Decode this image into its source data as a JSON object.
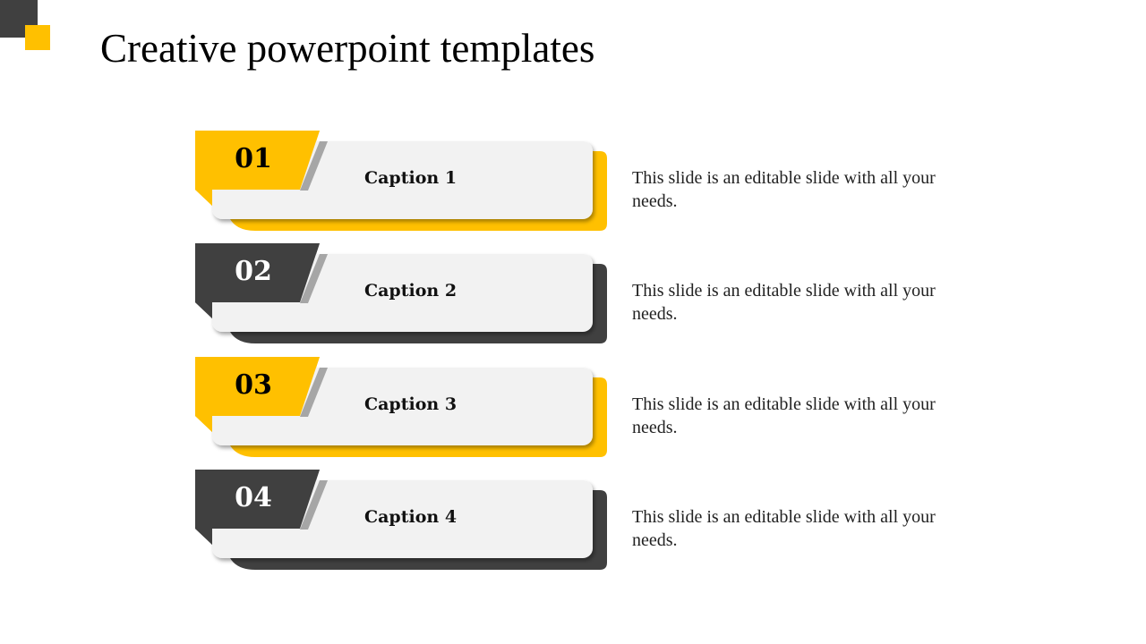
{
  "title": "Creative powerpoint templates",
  "colors": {
    "accent": "#FFC000",
    "dark": "#404040",
    "card": "#F2F2F2"
  },
  "items": [
    {
      "number": "01",
      "caption": "Caption 1",
      "text": "This slide is an editable slide with all your needs.",
      "color": "#FFC000",
      "number_color": "#000000"
    },
    {
      "number": "02",
      "caption": "Caption 2",
      "text": "This slide is an editable slide with all your needs.",
      "color": "#404040",
      "number_color": "#FFFFFF"
    },
    {
      "number": "03",
      "caption": "Caption 3",
      "text": "This slide is an editable slide with all your needs.",
      "color": "#FFC000",
      "number_color": "#000000"
    },
    {
      "number": "04",
      "caption": "Caption 4",
      "text": "This slide is an editable slide with all your needs.",
      "color": "#404040",
      "number_color": "#FFFFFF"
    }
  ]
}
